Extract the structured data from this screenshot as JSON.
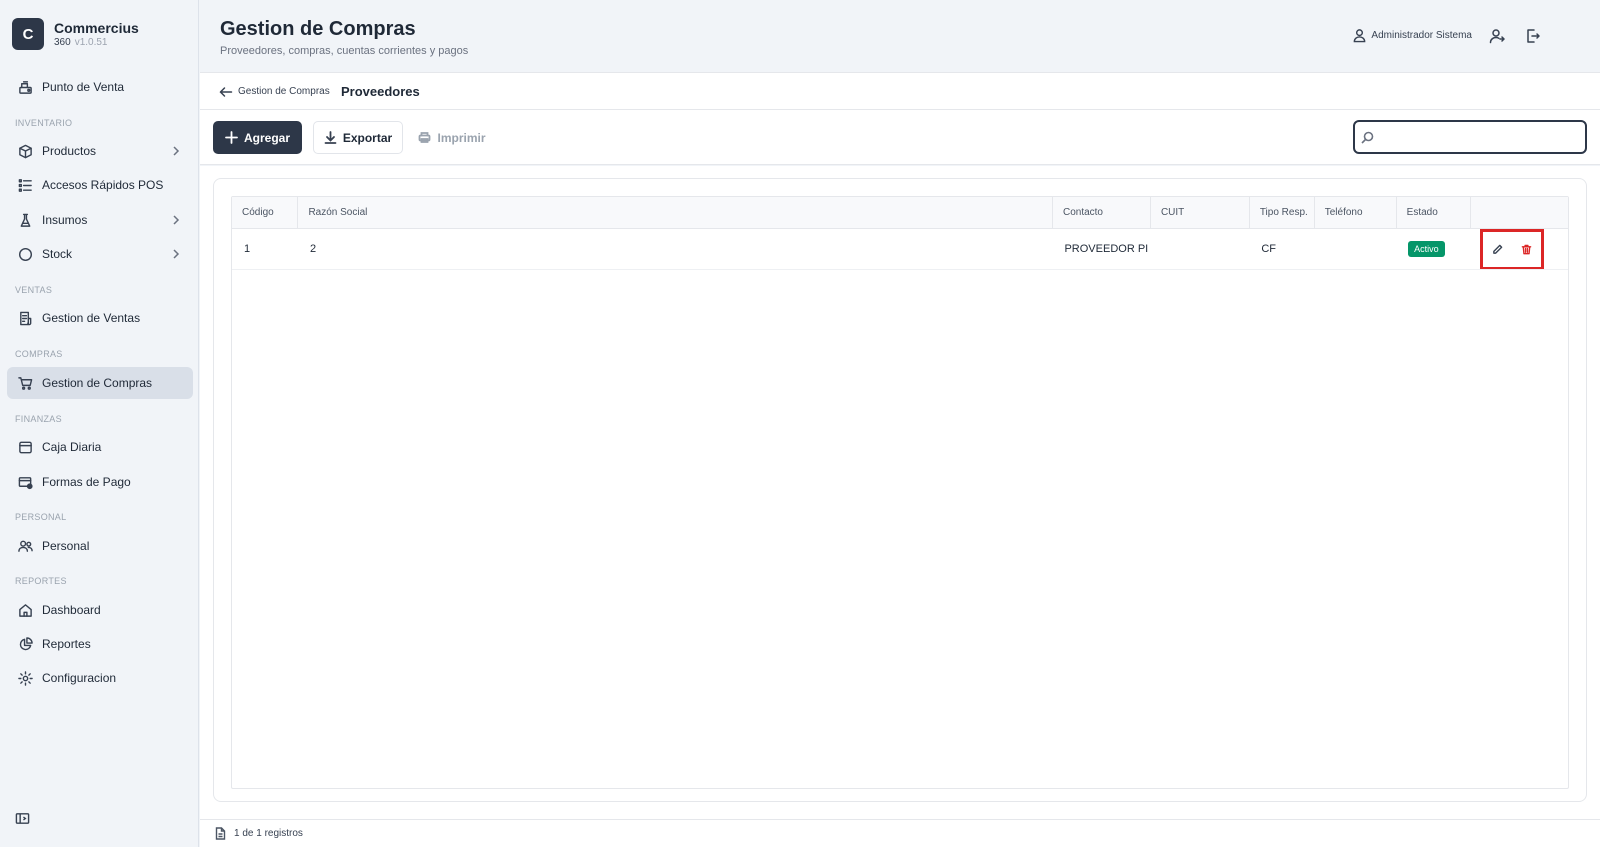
{
  "brand": {
    "logo_letter": "C",
    "name": "Commercius",
    "edition": "360",
    "version": "v1.0.51"
  },
  "sidebar": {
    "top_item": {
      "label": "Punto de Venta",
      "icon": "cash-register-icon"
    },
    "sections": [
      {
        "title": "INVENTARIO",
        "items": [
          {
            "label": "Productos",
            "icon": "box-icon",
            "has_chevron": true
          },
          {
            "label": "Accesos Rápidos POS",
            "icon": "list-icon",
            "has_chevron": false
          },
          {
            "label": "Insumos",
            "icon": "flask-icon",
            "has_chevron": true
          },
          {
            "label": "Stock",
            "icon": "circle-icon",
            "has_chevron": true
          }
        ]
      },
      {
        "title": "VENTAS",
        "items": [
          {
            "label": "Gestion de Ventas",
            "icon": "receipt-icon"
          }
        ]
      },
      {
        "title": "COMPRAS",
        "items": [
          {
            "label": "Gestion de Compras",
            "icon": "cart-icon",
            "active": true
          }
        ]
      },
      {
        "title": "FINANZAS",
        "items": [
          {
            "label": "Caja Diaria",
            "icon": "wallet-icon"
          },
          {
            "label": "Formas de Pago",
            "icon": "card-icon"
          }
        ]
      },
      {
        "title": "PERSONAL",
        "items": [
          {
            "label": "Personal",
            "icon": "users-icon"
          }
        ]
      },
      {
        "title": "REPORTES",
        "items": [
          {
            "label": "Dashboard",
            "icon": "home-icon"
          },
          {
            "label": "Reportes",
            "icon": "chart-pie-icon"
          },
          {
            "label": "Configuracion",
            "icon": "gear-icon"
          }
        ]
      }
    ]
  },
  "header": {
    "title": "Gestion de Compras",
    "subtitle": "Proveedores, compras, cuentas corrientes y pagos",
    "user_name": "Administrador Sistema"
  },
  "breadcrumb": {
    "parent": "Gestion de Compras",
    "current": "Proveedores"
  },
  "toolbar": {
    "add_label": "Agregar",
    "export_label": "Exportar",
    "print_label": "Imprimir",
    "search_placeholder": ""
  },
  "table": {
    "columns": [
      "Código",
      "Razón Social",
      "Contacto",
      "CUIT",
      "Tipo Resp.",
      "Teléfono",
      "Estado",
      ""
    ],
    "rows": [
      {
        "codigo": "1",
        "razon_social": "2",
        "contacto": "PROVEEDOR PI",
        "cuit": "",
        "tipo_resp": "CF",
        "telefono": "",
        "estado": "Activo"
      }
    ]
  },
  "footer": {
    "records_text": "1 de 1 registros"
  },
  "colors": {
    "primary": "#2d3748",
    "active_badge": "#059669",
    "delete": "#dc2626",
    "highlight": "#dc2626"
  }
}
